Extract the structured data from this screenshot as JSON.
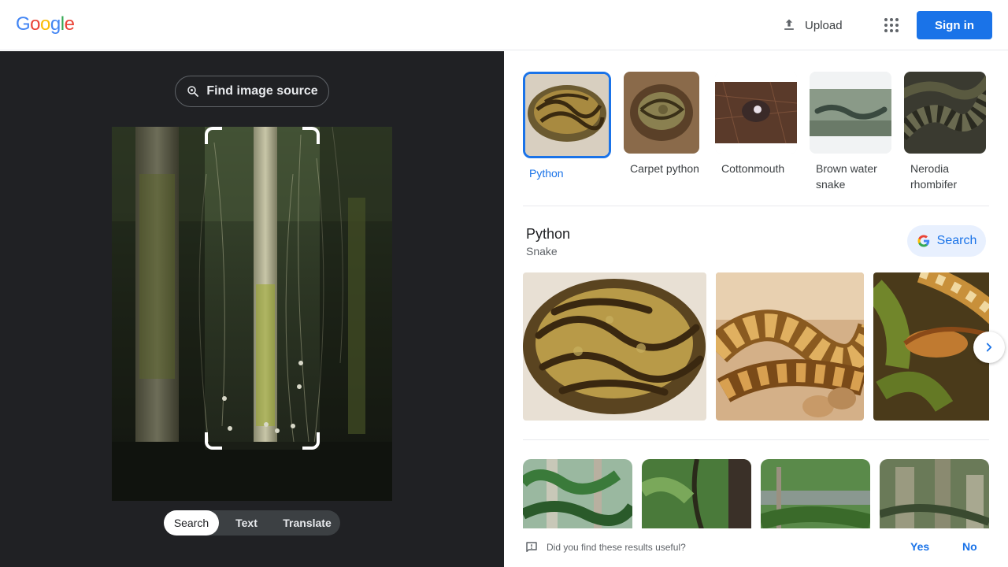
{
  "header": {
    "logo_letters": [
      {
        "ch": "G",
        "color": "#4285f4"
      },
      {
        "ch": "o",
        "color": "#ea4335"
      },
      {
        "ch": "o",
        "color": "#fbbc05"
      },
      {
        "ch": "g",
        "color": "#4285f4"
      },
      {
        "ch": "l",
        "color": "#34a853"
      },
      {
        "ch": "e",
        "color": "#ea4335"
      }
    ],
    "upload_label": "Upload",
    "signin_label": "Sign in",
    "accent": "#1a73e8"
  },
  "left_panel": {
    "find_source_label": "Find image source",
    "tabs": [
      {
        "label": "Search",
        "active": true
      },
      {
        "label": "Text",
        "active": false
      },
      {
        "label": "Translate",
        "active": false
      }
    ]
  },
  "results": {
    "chips": [
      {
        "label": "Python",
        "selected": true
      },
      {
        "label": "Carpet python",
        "selected": false
      },
      {
        "label": "Cottonmouth",
        "selected": false
      },
      {
        "label": "Brown water snake",
        "selected": false
      },
      {
        "label": "Nerodia rhombifer",
        "selected": false
      }
    ],
    "entity": {
      "title": "Python",
      "subtitle": "Snake",
      "search_label": "Search"
    },
    "feedback": {
      "question": "Did you find these results useful?",
      "yes": "Yes",
      "no": "No"
    }
  }
}
